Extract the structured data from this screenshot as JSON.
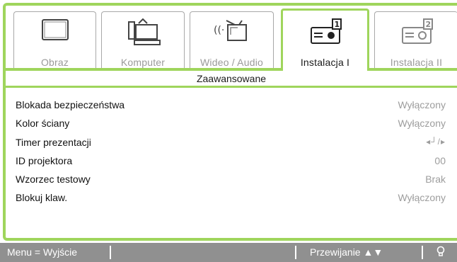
{
  "tabs": [
    {
      "label": "Obraz",
      "icon": "monitor-icon",
      "active": false
    },
    {
      "label": "Komputer",
      "icon": "computer-icon",
      "active": false
    },
    {
      "label": "Wideo / Audio",
      "icon": "video-audio-icon",
      "active": false
    },
    {
      "label": "Instalacja I",
      "icon": "projector-setup-icon",
      "active": true
    },
    {
      "label": "Instalacja II",
      "icon": "projector-setup-2-icon",
      "active": false
    }
  ],
  "section_title": "Zaawansowane",
  "rows": [
    {
      "label": "Blokada bezpieczeństwa",
      "value": "Wyłączony"
    },
    {
      "label": "Kolor ściany",
      "value": "Wyłączony"
    },
    {
      "label": "Timer prezentacji",
      "value": "◂┘/▸"
    },
    {
      "label": "ID projektora",
      "value": "00"
    },
    {
      "label": "Wzorzec testowy",
      "value": "Brak"
    },
    {
      "label": "Blokuj klaw.",
      "value": "Wyłączony"
    }
  ],
  "footer": {
    "left_hint": "Menu = Wyjście",
    "right_hint": "Przewijanie ▲▼",
    "bulb_icon": "lightbulb-icon"
  },
  "colors": {
    "accent": "#9fd55c",
    "footer_bg": "#909090",
    "value_text": "#9d9d9d"
  }
}
